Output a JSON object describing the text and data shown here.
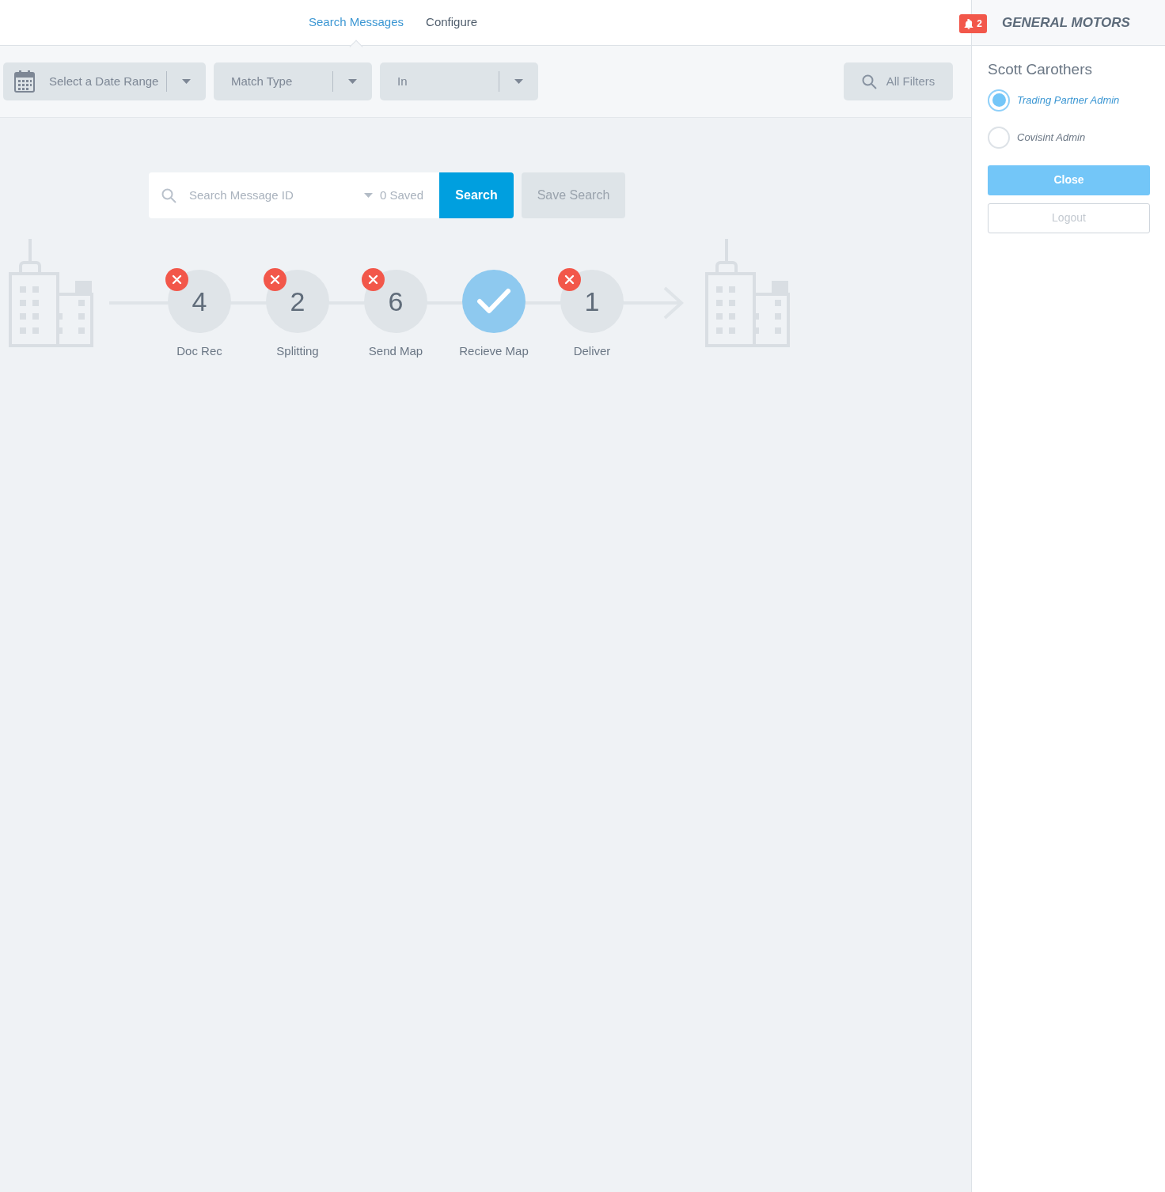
{
  "nav": {
    "tabs": [
      {
        "label": "Search Messages",
        "selected": true
      },
      {
        "label": "Configure",
        "selected": false
      }
    ]
  },
  "notifications": {
    "count": "2"
  },
  "company": "GENERAL MOTORS",
  "filters": [
    {
      "kind": "date",
      "label": "Select a Date Range"
    },
    {
      "kind": "select",
      "label": "Match Type"
    },
    {
      "kind": "select",
      "label": "In"
    }
  ],
  "all_filters": "All Filters",
  "search": {
    "placeholder": "Search Message ID",
    "saved": "0 Saved",
    "button": "Search",
    "save_button": "Save Search"
  },
  "pipeline": [
    {
      "label": "Doc Rec",
      "kind": "error",
      "count": "4"
    },
    {
      "label": "Splitting",
      "kind": "error",
      "count": "2"
    },
    {
      "label": "Send Map",
      "kind": "error",
      "count": "6"
    },
    {
      "label": "Recieve Map",
      "kind": "ok"
    },
    {
      "label": "Deliver",
      "kind": "error",
      "count": "1"
    }
  ],
  "user_panel": {
    "name": "Scott Carothers",
    "roles": [
      {
        "label": "Trading Partner Admin",
        "selected": true
      },
      {
        "label": "Covisint Admin",
        "selected": false
      }
    ],
    "close": "Close",
    "logout": "Logout"
  }
}
